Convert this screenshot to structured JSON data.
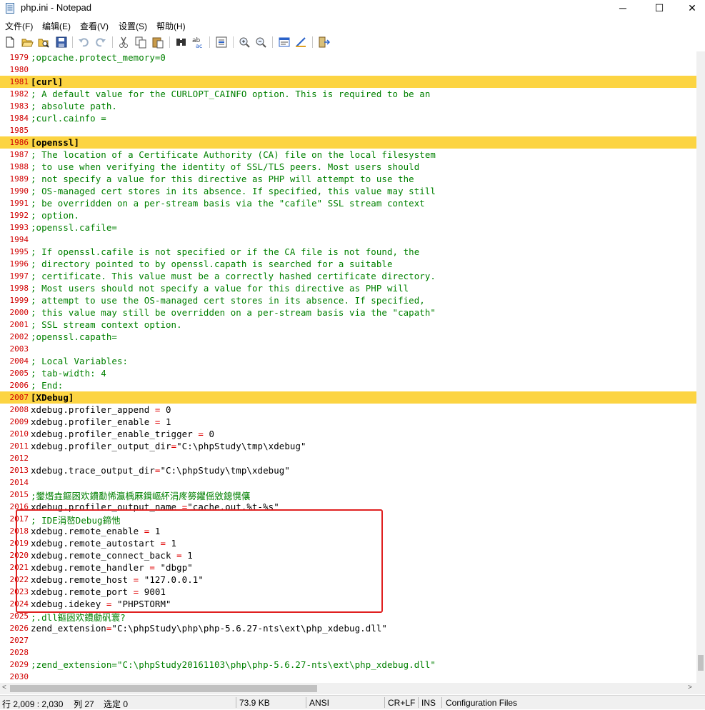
{
  "window": {
    "title": "php.ini - Notepad",
    "minimize": "─",
    "maximize": "☐",
    "close": "✕"
  },
  "menu": {
    "items": [
      "文件(F)",
      "编辑(E)",
      "查看(V)",
      "设置(S)",
      "帮助(H)"
    ]
  },
  "toolbar": {
    "icons": [
      "new-file-icon",
      "open-file-icon",
      "reload-icon",
      "save-icon",
      "undo-icon",
      "redo-icon",
      "cut-icon",
      "copy-icon",
      "paste-icon",
      "find-icon",
      "replace-icon",
      "goto-icon",
      "zoom-in-icon",
      "zoom-out-icon",
      "wordwrap-icon",
      "scheme-icon",
      "exit-icon"
    ]
  },
  "editor": {
    "lines": [
      {
        "n": "1979",
        "t": ";opcache.protect_memory=0",
        "k": "comment"
      },
      {
        "n": "1980",
        "t": "",
        "k": "plain"
      },
      {
        "n": "1981",
        "t": "[curl]",
        "k": "section"
      },
      {
        "n": "1982",
        "t": "; A default value for the CURLOPT_CAINFO option. This is required to be an",
        "k": "comment"
      },
      {
        "n": "1983",
        "t": "; absolute path.",
        "k": "comment"
      },
      {
        "n": "1984",
        "t": ";curl.cainfo =",
        "k": "comment"
      },
      {
        "n": "1985",
        "t": "",
        "k": "plain"
      },
      {
        "n": "1986",
        "t": "[openssl]",
        "k": "section"
      },
      {
        "n": "1987",
        "t": "; The location of a Certificate Authority (CA) file on the local filesystem",
        "k": "comment"
      },
      {
        "n": "1988",
        "t": "; to use when verifying the identity of SSL/TLS peers. Most users should",
        "k": "comment"
      },
      {
        "n": "1989",
        "t": "; not specify a value for this directive as PHP will attempt to use the",
        "k": "comment"
      },
      {
        "n": "1990",
        "t": "; OS-managed cert stores in its absence. If specified, this value may still",
        "k": "comment"
      },
      {
        "n": "1991",
        "t": "; be overridden on a per-stream basis via the \"cafile\" SSL stream context",
        "k": "comment"
      },
      {
        "n": "1992",
        "t": "; option.",
        "k": "comment"
      },
      {
        "n": "1993",
        "t": ";openssl.cafile=",
        "k": "comment"
      },
      {
        "n": "1994",
        "t": "",
        "k": "plain"
      },
      {
        "n": "1995",
        "t": "; If openssl.cafile is not specified or if the CA file is not found, the",
        "k": "comment"
      },
      {
        "n": "1996",
        "t": "; directory pointed to by openssl.capath is searched for a suitable",
        "k": "comment"
      },
      {
        "n": "1997",
        "t": "; certificate. This value must be a correctly hashed certificate directory.",
        "k": "comment"
      },
      {
        "n": "1998",
        "t": "; Most users should not specify a value for this directive as PHP will",
        "k": "comment"
      },
      {
        "n": "1999",
        "t": "; attempt to use the OS-managed cert stores in its absence. If specified,",
        "k": "comment"
      },
      {
        "n": "2000",
        "t": "; this value may still be overridden on a per-stream basis via the \"capath\"",
        "k": "comment"
      },
      {
        "n": "2001",
        "t": "; SSL stream context option.",
        "k": "comment"
      },
      {
        "n": "2002",
        "t": ";openssl.capath=",
        "k": "comment"
      },
      {
        "n": "2003",
        "t": "",
        "k": "plain"
      },
      {
        "n": "2004",
        "t": "; Local Variables:",
        "k": "comment"
      },
      {
        "n": "2005",
        "t": "; tab-width: 4",
        "k": "comment"
      },
      {
        "n": "2006",
        "t": "; End:",
        "k": "comment"
      },
      {
        "n": "2007",
        "t": "[XDebug]",
        "k": "section"
      },
      {
        "n": "2008",
        "t": "xdebug.profiler_append = 0",
        "k": "kv"
      },
      {
        "n": "2009",
        "t": "xdebug.profiler_enable = 1",
        "k": "kv"
      },
      {
        "n": "2010",
        "t": "xdebug.profiler_enable_trigger = 0",
        "k": "kv"
      },
      {
        "n": "2011",
        "t": "xdebug.profiler_output_dir=\"C:\\phpStudy\\tmp\\xdebug\"",
        "k": "kv"
      },
      {
        "n": "2012",
        "t": "",
        "k": "plain"
      },
      {
        "n": "2013",
        "t": "xdebug.trace_output_dir=\"C:\\phpStudy\\tmp\\xdebug\"",
        "k": "kv"
      },
      {
        "n": "2014",
        "t": "",
        "k": "plain"
      },
      {
        "n": "2015",
        "t": ";鐢熸垚鏂囦欢鐨勫悕瀛楀厤鍓嶇紑涓庝簩鑺傜敓鎴愰儴",
        "k": "comment"
      },
      {
        "n": "2016",
        "t": "xdebug.profiler_output_name =\"cache.out.%t-%s\"",
        "k": "kv"
      },
      {
        "n": "2017",
        "t": "; IDE涓嶅Debug鍗忚",
        "k": "comment"
      },
      {
        "n": "2018",
        "t": "xdebug.remote_enable = 1",
        "k": "kv"
      },
      {
        "n": "2019",
        "t": "xdebug.remote_autostart = 1",
        "k": "kv"
      },
      {
        "n": "2020",
        "t": "xdebug.remote_connect_back = 1",
        "k": "kv"
      },
      {
        "n": "2021",
        "t": "xdebug.remote_handler = \"dbgp\"",
        "k": "kv"
      },
      {
        "n": "2022",
        "t": "xdebug.remote_host = \"127.0.0.1\"",
        "k": "kv"
      },
      {
        "n": "2023",
        "t": "xdebug.remote_port = 9001",
        "k": "kv"
      },
      {
        "n": "2024",
        "t": "xdebug.idekey = \"PHPSTORM\"",
        "k": "kv"
      },
      {
        "n": "2025",
        "t": ";.dll鏂囦欢鐨勮矾寰?",
        "k": "comment"
      },
      {
        "n": "2026",
        "t": "zend_extension=\"C:\\phpStudy\\php\\php-5.6.27-nts\\ext\\php_xdebug.dll\"",
        "k": "kv"
      },
      {
        "n": "2027",
        "t": "",
        "k": "plain"
      },
      {
        "n": "2028",
        "t": "",
        "k": "plain"
      },
      {
        "n": "2029",
        "t": ";zend_extension=\"C:\\phpStudy20161103\\php\\php-5.6.27-nts\\ext\\php_xdebug.dll\"",
        "k": "comment"
      },
      {
        "n": "2030",
        "t": "",
        "k": "plain"
      }
    ]
  },
  "statusbar": {
    "position": "行 2,009 : 2,030",
    "column": "列 27",
    "selection": "选定 0",
    "size": "73.9 KB",
    "encoding": "ANSI",
    "eol": "CR+LF",
    "mode": "INS",
    "scheme": "Configuration Files"
  },
  "scrollbars": {
    "left_arrow": "<",
    "right_arrow": ">"
  }
}
